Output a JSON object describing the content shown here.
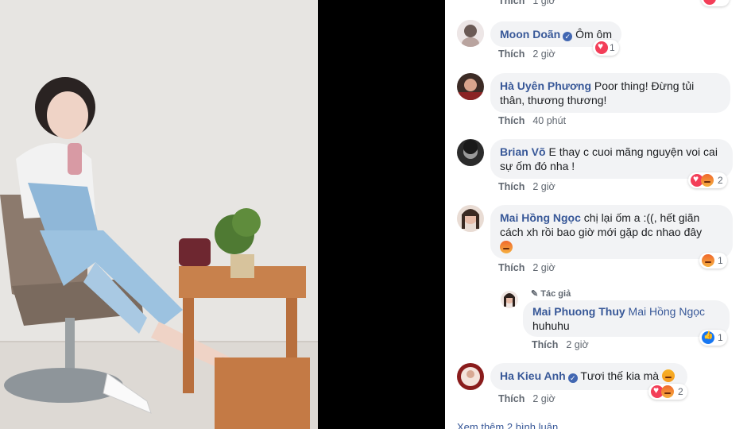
{
  "top_partial": {
    "like": "Thích",
    "time": "1 giờ"
  },
  "comments": [
    {
      "author": "Moon Doãn",
      "text": "Ôm ôm",
      "like": "Thích",
      "time": "2 giờ",
      "reactions": "1"
    },
    {
      "author": "Hà Uyên Phương",
      "text_line1": "Poor thing! Đừng tủi",
      "text_line2": "thân, thương thương!",
      "like": "Thích",
      "time": "40 phút"
    },
    {
      "author": "Brian Võ",
      "text_line1": "E thay c cuoi mãng nguyện voi cai",
      "text_line2": "sự ốm đó nha !",
      "like": "Thích",
      "time": "2 giờ",
      "reactions": "2"
    },
    {
      "author": "Mai Hồng Ngọc",
      "text_line1": "chị lại ốm a :((, hết giãn",
      "text_line2": "cách xh rồi bao giờ mới gặp dc nhao đây",
      "like": "Thích",
      "time": "2 giờ",
      "reactions": "1"
    },
    {
      "author": "Ha Kieu Anh",
      "text": "Tươi thế kia mà",
      "like": "Thích",
      "time": "2 giờ",
      "reactions": "2"
    }
  ],
  "reply": {
    "badge": "Tác giả",
    "author": "Mai Phuong Thuy",
    "mention": "Mai Hồng Ngọc",
    "text": "huhuhu",
    "like": "Thích",
    "time": "2 giờ",
    "reactions": "1"
  },
  "more_link": "Xem thêm 2 bình luận"
}
